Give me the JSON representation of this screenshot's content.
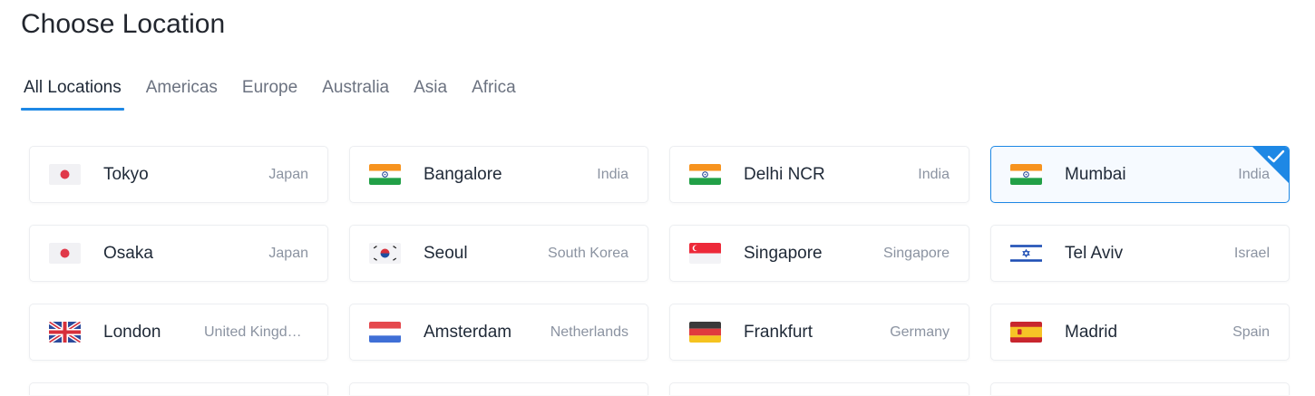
{
  "page": {
    "title": "Choose Location"
  },
  "tabs": [
    {
      "label": "All Locations"
    },
    {
      "label": "Americas"
    },
    {
      "label": "Europe"
    },
    {
      "label": "Australia"
    },
    {
      "label": "Asia"
    },
    {
      "label": "Africa"
    }
  ],
  "locations": [
    {
      "city": "Tokyo",
      "country": "Japan",
      "flag": "japan-flag-icon"
    },
    {
      "city": "Bangalore",
      "country": "India",
      "flag": "india-flag-icon"
    },
    {
      "city": "Delhi NCR",
      "country": "India",
      "flag": "india-flag-icon"
    },
    {
      "city": "Mumbai",
      "country": "India",
      "flag": "india-flag-icon",
      "selected": true
    },
    {
      "city": "Osaka",
      "country": "Japan",
      "flag": "japan-flag-icon"
    },
    {
      "city": "Seoul",
      "country": "South Korea",
      "flag": "south-korea-flag-icon"
    },
    {
      "city": "Singapore",
      "country": "Singapore",
      "flag": "singapore-flag-icon"
    },
    {
      "city": "Tel Aviv",
      "country": "Israel",
      "flag": "israel-flag-icon"
    },
    {
      "city": "London",
      "country": "United Kingdo…",
      "flag": "uk-flag-icon"
    },
    {
      "city": "Amsterdam",
      "country": "Netherlands",
      "flag": "netherlands-flag-icon"
    },
    {
      "city": "Frankfurt",
      "country": "Germany",
      "flag": "germany-flag-icon"
    },
    {
      "city": "Madrid",
      "country": "Spain",
      "flag": "spain-flag-icon"
    }
  ],
  "colors": {
    "accent": "#1e88e5"
  }
}
